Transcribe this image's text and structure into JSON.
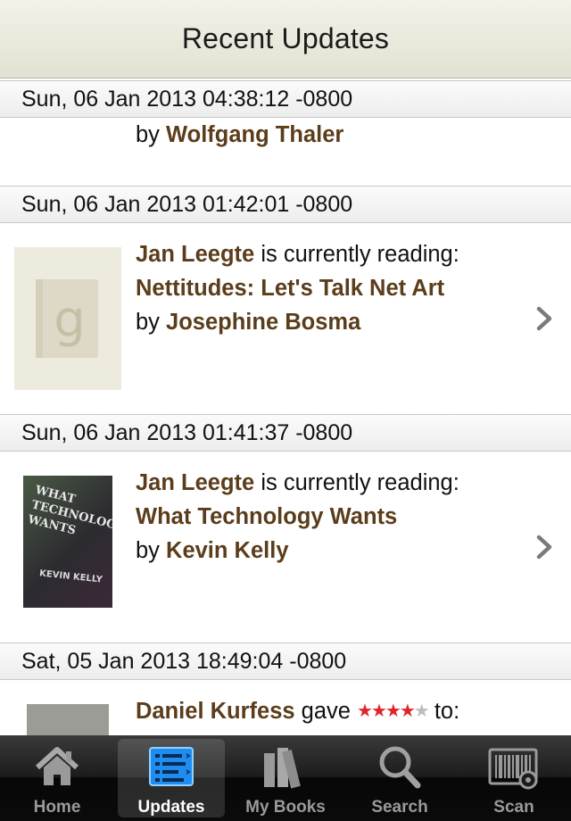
{
  "nav": {
    "title": "Recent Updates"
  },
  "updates": [
    {
      "date": "Sun, 06 Jan 2013 04:38:12 -0800",
      "by_label": "by",
      "author": "Wolfgang Thaler"
    },
    {
      "date": "Sun, 06 Jan 2013 01:42:01 -0800",
      "user": "Jan Leegte",
      "action": "is currently reading:",
      "book_title": "Nettitudes: Let's Talk Net Art",
      "by_label": "by",
      "author": "Josephine Bosma",
      "cover": "goodreads-placeholder-icon"
    },
    {
      "date": "Sun, 06 Jan 2013 01:41:37 -0800",
      "user": "Jan Leegte",
      "action": "is currently reading:",
      "book_title": "What Technology Wants",
      "by_label": "by",
      "author": "Kevin Kelly",
      "cover": "book-cover",
      "cover_text": [
        "WHAT",
        "TECHNOLOGY",
        "WANTS",
        "KEVIN KELLY"
      ]
    },
    {
      "date": "Sat, 05 Jan 2013 18:49:04 -0800",
      "user": "Daniel Kurfess",
      "action": "gave",
      "rating": 4,
      "rating_max": 5,
      "suffix": "to:"
    }
  ],
  "tabs": [
    {
      "label": "Home",
      "icon": "home-icon",
      "active": false
    },
    {
      "label": "Updates",
      "icon": "updates-icon",
      "active": true
    },
    {
      "label": "My Books",
      "icon": "books-icon",
      "active": false
    },
    {
      "label": "Search",
      "icon": "search-icon",
      "active": false
    },
    {
      "label": "Scan",
      "icon": "barcode-icon",
      "active": false
    }
  ],
  "colors": {
    "link_brown": "#5b3d1b",
    "star_red": "#e0242c",
    "nav_bg": "#e9e7d9"
  }
}
